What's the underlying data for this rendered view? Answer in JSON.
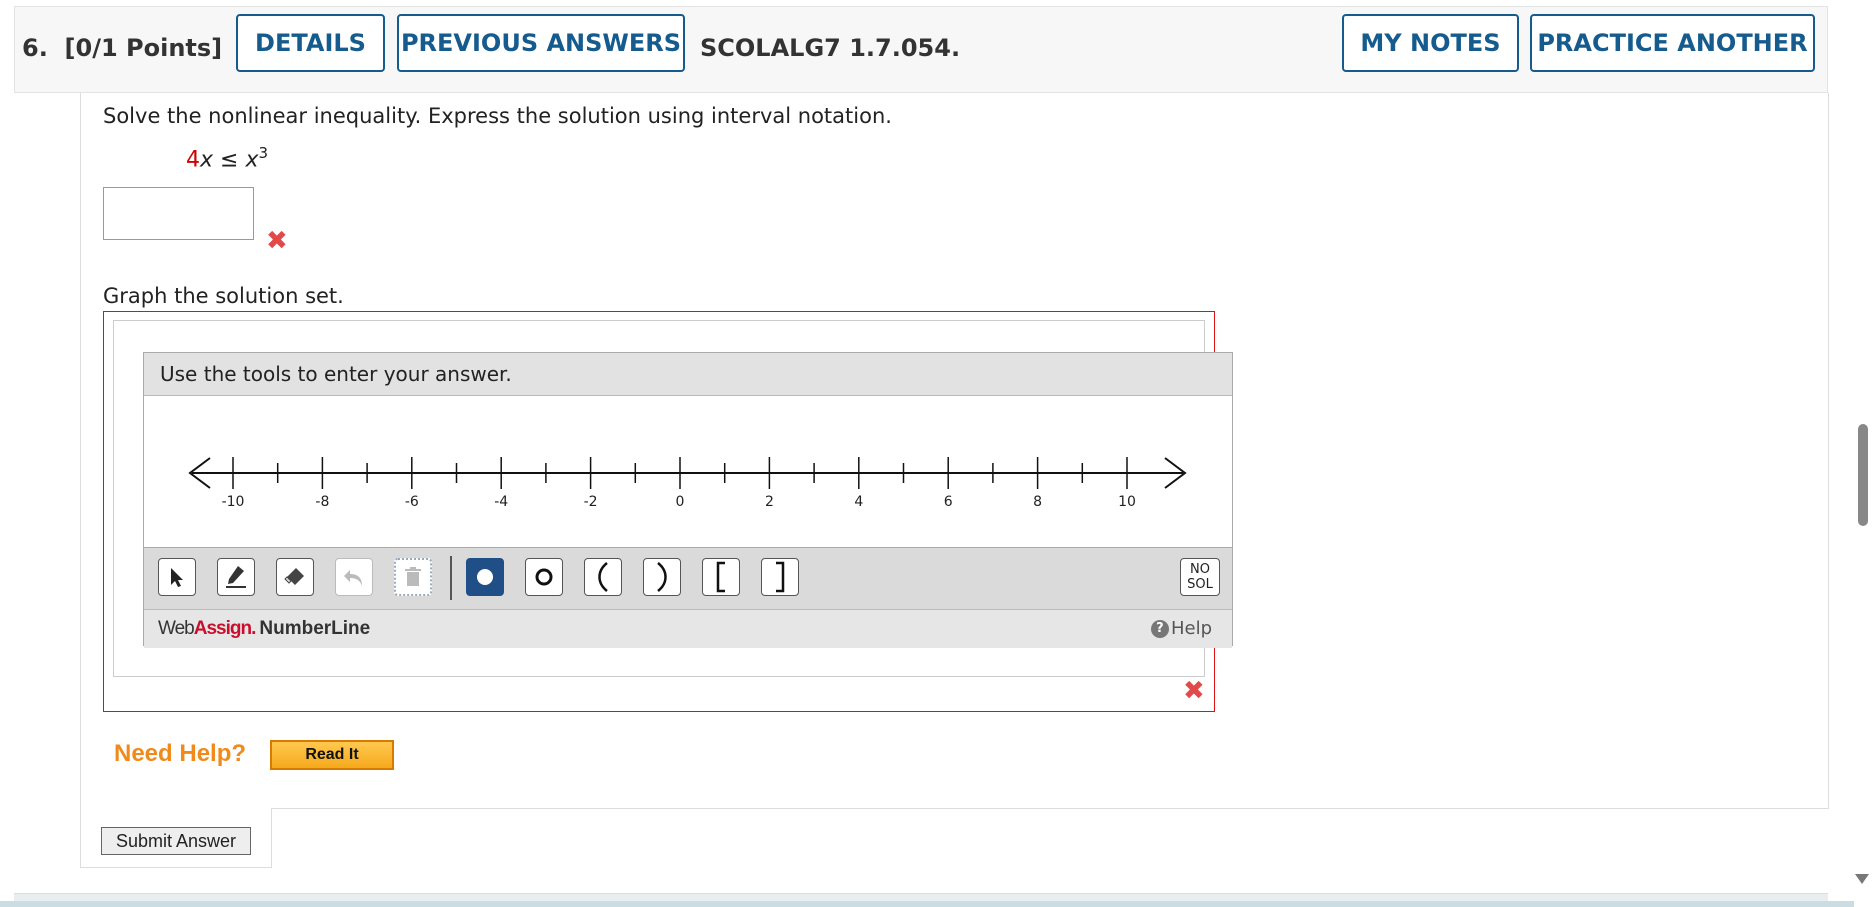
{
  "header": {
    "question_number": "6.",
    "points": "[0/1 Points]",
    "details_label": "DETAILS",
    "previous_answers_label": "PREVIOUS ANSWERS",
    "question_code": "SCOLALG7 1.7.054.",
    "my_notes_label": "MY NOTES",
    "practice_another_label": "PRACTICE ANOTHER"
  },
  "question": {
    "prompt": "Solve the nonlinear inequality. Express the solution using interval notation.",
    "inequality_coef": "4",
    "inequality_var": "x",
    "inequality_rel": " ≤ x",
    "inequality_exp": "3",
    "answer_value": "",
    "graph_prompt": "Graph the solution set."
  },
  "numberline": {
    "instructions": "Use the tools to enter your answer.",
    "tick_labels": [
      "-10",
      "-8",
      "-6",
      "-4",
      "-2",
      "0",
      "2",
      "4",
      "6",
      "8",
      "10"
    ],
    "nosol_line1": "NO",
    "nosol_line2": "SOL",
    "brand_web": "Web",
    "brand_assign": "Assign",
    "brand_dot": ".",
    "brand_product": "NumberLine",
    "help_label": "Help",
    "tools": [
      "pointer-icon",
      "pencil-icon",
      "eraser-icon",
      "undo-icon",
      "trash-icon",
      "filled-dot-icon",
      "open-dot-icon",
      "left-paren-icon",
      "right-paren-icon",
      "left-bracket-icon",
      "right-bracket-icon"
    ]
  },
  "help": {
    "need_help": "Need Help?",
    "read_it": "Read It"
  },
  "submit_label": "Submit Answer",
  "colors": {
    "accent": "#155b8e",
    "error": "#e24a4a",
    "brand_red": "#c8102e",
    "help_orange": "#f08a1a"
  }
}
